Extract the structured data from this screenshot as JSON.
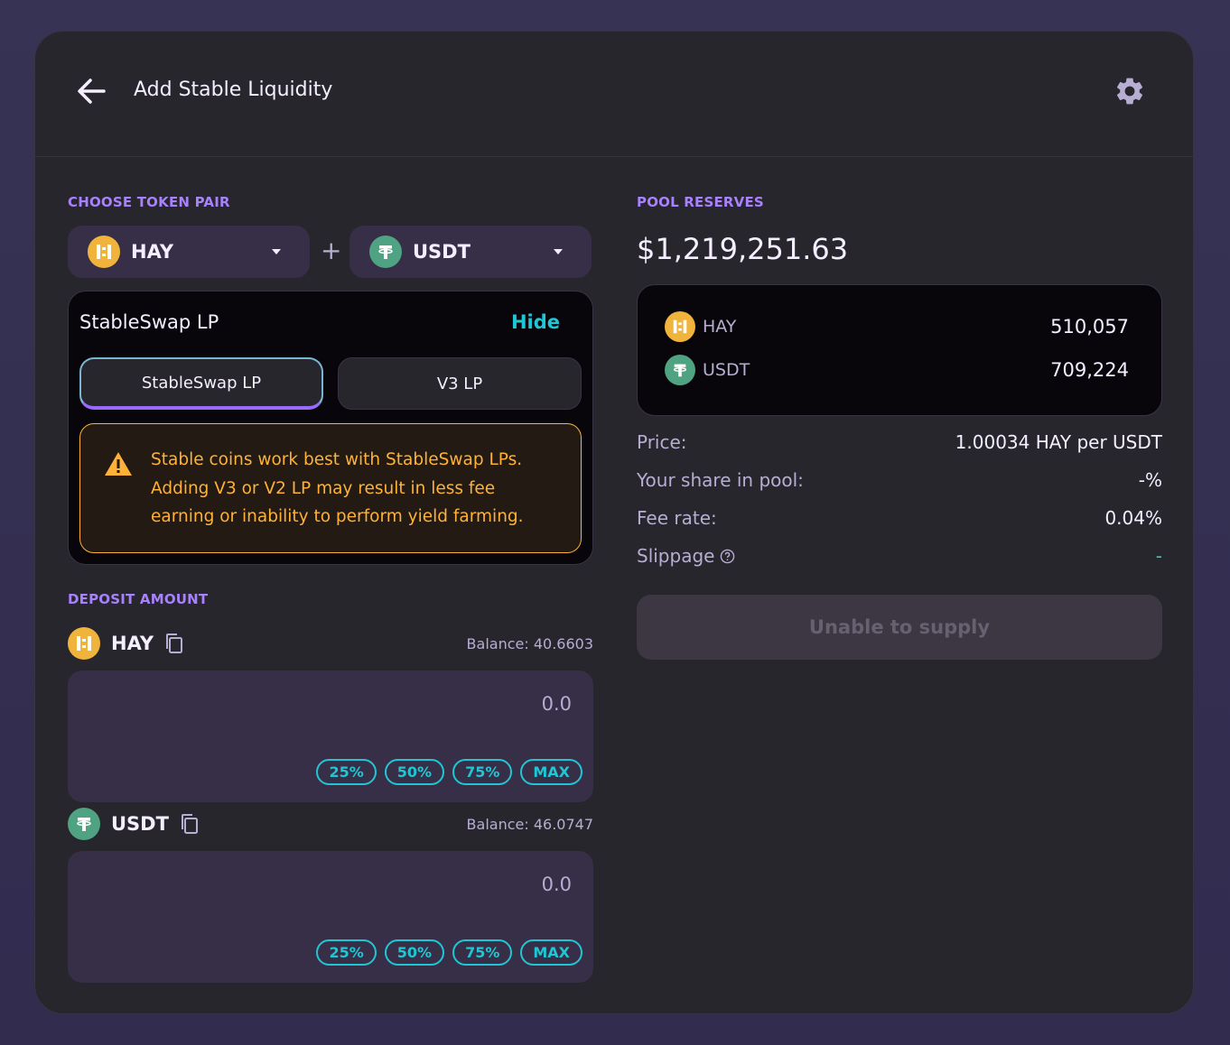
{
  "header": {
    "title": "Add Stable Liquidity",
    "back_icon": "arrow-left-icon",
    "settings_icon": "gear-icon"
  },
  "token_pair": {
    "label": "CHOOSE TOKEN PAIR",
    "token_a": "HAY",
    "token_b": "USDT",
    "plus": "+"
  },
  "lp_type": {
    "title": "StableSwap LP",
    "hide_label": "Hide",
    "options": [
      "StableSwap LP",
      "V3 LP"
    ],
    "selected": "StableSwap LP",
    "warning_lines": [
      "Stable coins work best with StableSwap LPs.",
      "Adding V3 or V2 LP may result in less fee",
      "earning or inability to perform yield farming."
    ]
  },
  "deposit": {
    "label": "DEPOSIT AMOUNT",
    "tokens": [
      {
        "symbol": "HAY",
        "balance": "Balance: 40.6603",
        "placeholder": "0.0"
      },
      {
        "symbol": "USDT",
        "balance": "Balance: 46.0747",
        "placeholder": "0.0"
      }
    ],
    "percent_buttons": [
      "25%",
      "50%",
      "75%",
      "MAX"
    ]
  },
  "pool": {
    "label": "POOL RESERVES",
    "total": "$1,219,251.63",
    "reserves": [
      {
        "symbol": "HAY",
        "amount": "510,057"
      },
      {
        "symbol": "USDT",
        "amount": "709,224"
      }
    ],
    "price_label": "Price:",
    "price_value": "1.00034 HAY per USDT",
    "share_label": "Your share in pool:",
    "share_value": "-%",
    "fee_label": "Fee rate:",
    "fee_value": "0.04%",
    "slippage_label": "Slippage",
    "slippage_value": "-"
  },
  "supply_button": "Unable to supply",
  "colors": {
    "accent_purple": "#a881fc",
    "accent_cyan": "#1fc7d4",
    "warning": "#ffb237",
    "hay": "#f0b43c",
    "usdt": "#4fa382"
  }
}
